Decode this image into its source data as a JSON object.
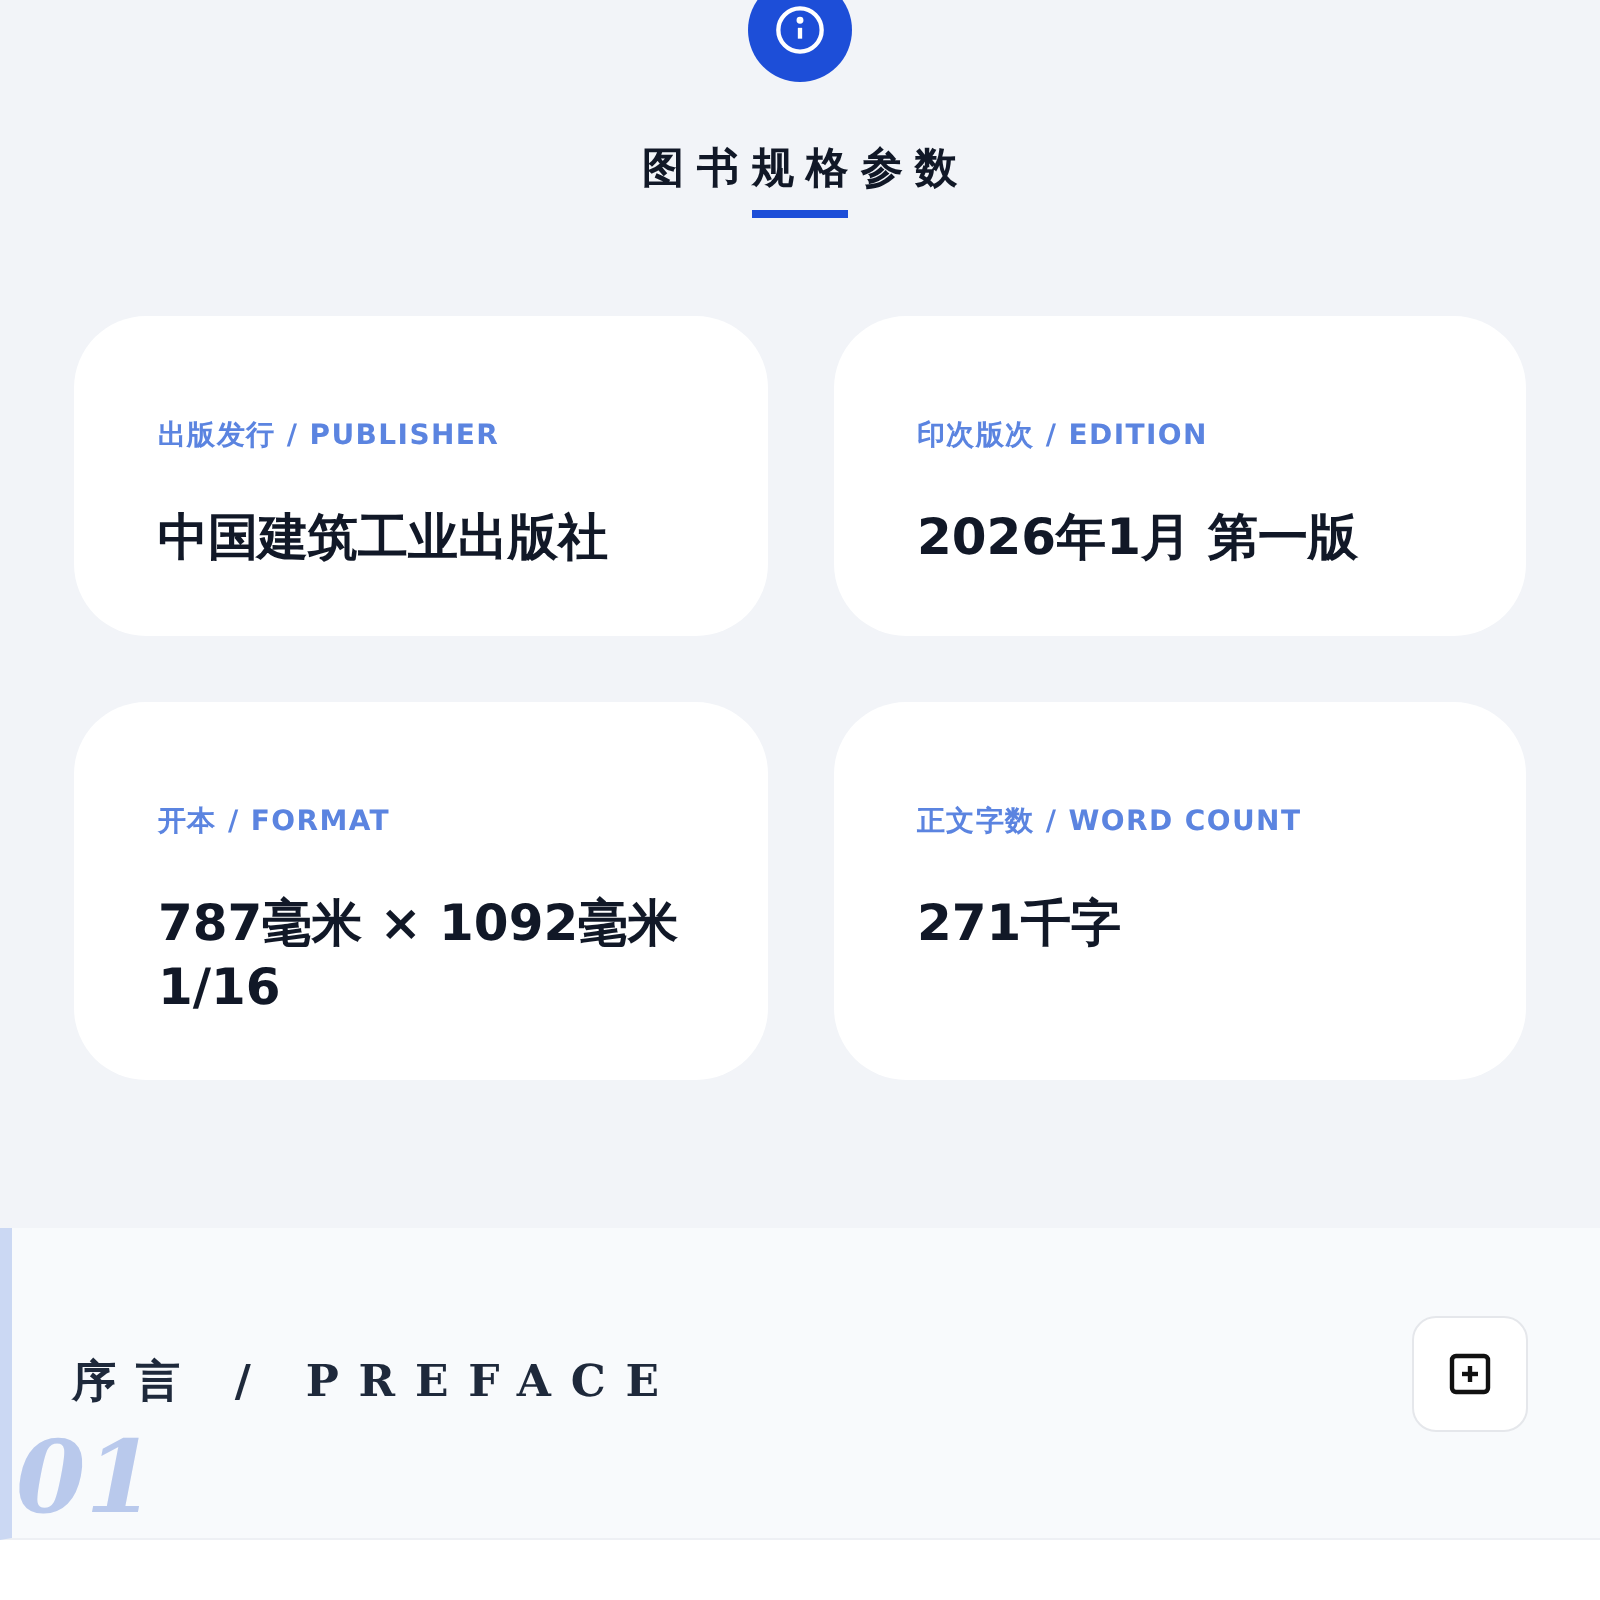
{
  "section_title": "图书规格参数",
  "specs": [
    {
      "label": "出版发行 / PUBLISHER",
      "value": "中国建筑工业出版社"
    },
    {
      "label": "印次版次 / EDITION",
      "value": "2026年1月 第一版"
    },
    {
      "label": "开本 / FORMAT",
      "value": "787毫米 × 1092毫米 1/16"
    },
    {
      "label": "正文字数 / WORD COUNT",
      "value": "271千字"
    }
  ],
  "preface": {
    "number": "01",
    "title": "序言 / PREFACE",
    "expanded": false
  }
}
